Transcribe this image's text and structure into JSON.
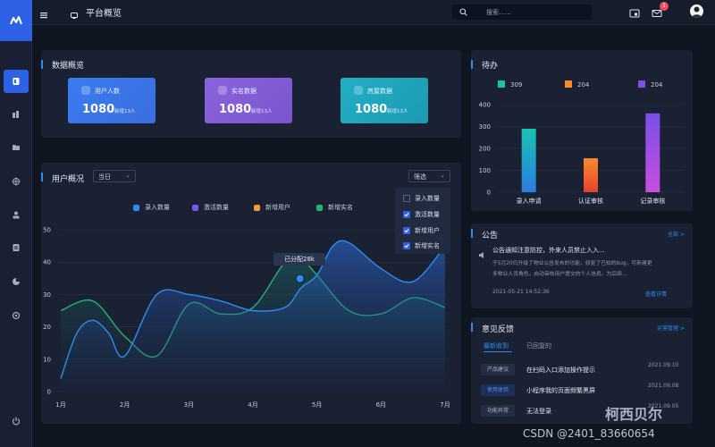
{
  "header": {
    "page_title": "平台概览",
    "search_placeholder": "搜索……",
    "mail_badge": "1"
  },
  "nav": {
    "icons": [
      "logo-icon",
      "dashboard-icon",
      "bar-icon",
      "folder-icon",
      "target-icon",
      "user-icon",
      "doc-icon",
      "pie-icon",
      "settings-icon",
      "power-icon"
    ]
  },
  "overview": {
    "title": "数据概览",
    "stats": [
      {
        "label": "用户人数",
        "value": "1080",
        "sub": "新增13人",
        "color": "#3c7df0"
      },
      {
        "label": "实名数据",
        "value": "1080",
        "sub": "新增13人",
        "color": "#8560d6"
      },
      {
        "label": "房屋数据",
        "value": "1080",
        "sub": "新增13人",
        "color": "#1ea8c0"
      }
    ]
  },
  "user_overview": {
    "title": "用户概况",
    "period_select": "当日",
    "filter_label": "筛选",
    "legend": [
      {
        "name": "录入数量",
        "color": "#2d8cf0"
      },
      {
        "name": "激活数量",
        "color": "#7a56f0"
      },
      {
        "name": "新增用户",
        "color": "#f59b2f"
      },
      {
        "name": "新增实名",
        "color": "#22b573"
      }
    ],
    "filter_options": [
      {
        "label": "录入数量",
        "checked": false
      },
      {
        "label": "激活数量",
        "checked": true
      },
      {
        "label": "新增用户",
        "checked": true
      },
      {
        "label": "新增实名",
        "checked": true
      }
    ],
    "tooltip": "已分配28k"
  },
  "todo": {
    "title": "待办"
  },
  "notice": {
    "title": "公告",
    "more": "全部 >",
    "headline": "公告通知注意防控，外来人员禁止入入...",
    "body_line1": "于5月20日升级了物业公告发布的功能，修复了已知的bug，可新建更",
    "body_line2": "多物业人员角色，自动审核用户提交的个人信息。为后续...",
    "time": "2021-05-21 14:52:36",
    "detail": "查看详情"
  },
  "feedback": {
    "title": "意见反馈",
    "manage": "运营管理 >",
    "tabs": [
      "最新收到",
      "已回复的"
    ],
    "items": [
      {
        "tag": "产品建议",
        "text": "在扫码入口添加操作提示",
        "date": "2021.09.10"
      },
      {
        "tag": "使用体验",
        "text": "小程序我的页面频繁黑屏",
        "date": "2021.09.08"
      },
      {
        "tag": "功能异常",
        "text": "无法登录",
        "date": "2021.09.05"
      }
    ]
  },
  "watermark": {
    "text": "柯西贝尔",
    "csdn": "CSDN @2401_83660654"
  },
  "chart_data": [
    {
      "type": "area",
      "title": "用户概况",
      "categories": [
        "1月",
        "2月",
        "3月",
        "4月",
        "5月",
        "6月",
        "7月"
      ],
      "ylim": [
        0,
        50
      ],
      "yticks": [
        0,
        10,
        20,
        30,
        40,
        50
      ],
      "series": [
        {
          "name": "录入数量",
          "color": "#2d8cf0",
          "x": [
            0,
            0.25,
            0.5,
            0.75,
            1,
            1.5,
            2,
            2.5,
            3,
            3.5,
            3.75,
            4,
            4.25,
            4.5,
            5,
            5.5,
            6
          ],
          "values": [
            4,
            18,
            22,
            18,
            11,
            30,
            30,
            28,
            25,
            26,
            32,
            36,
            45,
            46,
            38,
            34,
            45
          ]
        },
        {
          "name": "新增实名",
          "color": "#22b573",
          "x": [
            0,
            0.5,
            1,
            1.5,
            2,
            2.5,
            3,
            3.5,
            3.75,
            4,
            4.5,
            5,
            5.5,
            6
          ],
          "values": [
            25,
            28,
            17,
            11,
            27,
            24,
            26,
            40,
            41,
            36,
            25,
            24,
            29,
            26
          ]
        }
      ],
      "highlight": {
        "category_index": 4,
        "value": 36,
        "label": "已分配28k"
      },
      "grid": true
    },
    {
      "type": "bar",
      "title": "待办",
      "categories": [
        "录入申请",
        "认证审核",
        "记录审核"
      ],
      "values": [
        290,
        155,
        360
      ],
      "legend": [
        "309",
        "204",
        "204"
      ],
      "colors": [
        [
          "#19c3b3",
          "#2a7de1"
        ],
        [
          "#f98a2e",
          "#e8422c"
        ],
        [
          "#7b4fe8",
          "#c74ee0"
        ]
      ],
      "ylim": [
        0,
        400
      ],
      "yticks": [
        0,
        100,
        200,
        300,
        400
      ],
      "grid": true
    }
  ]
}
